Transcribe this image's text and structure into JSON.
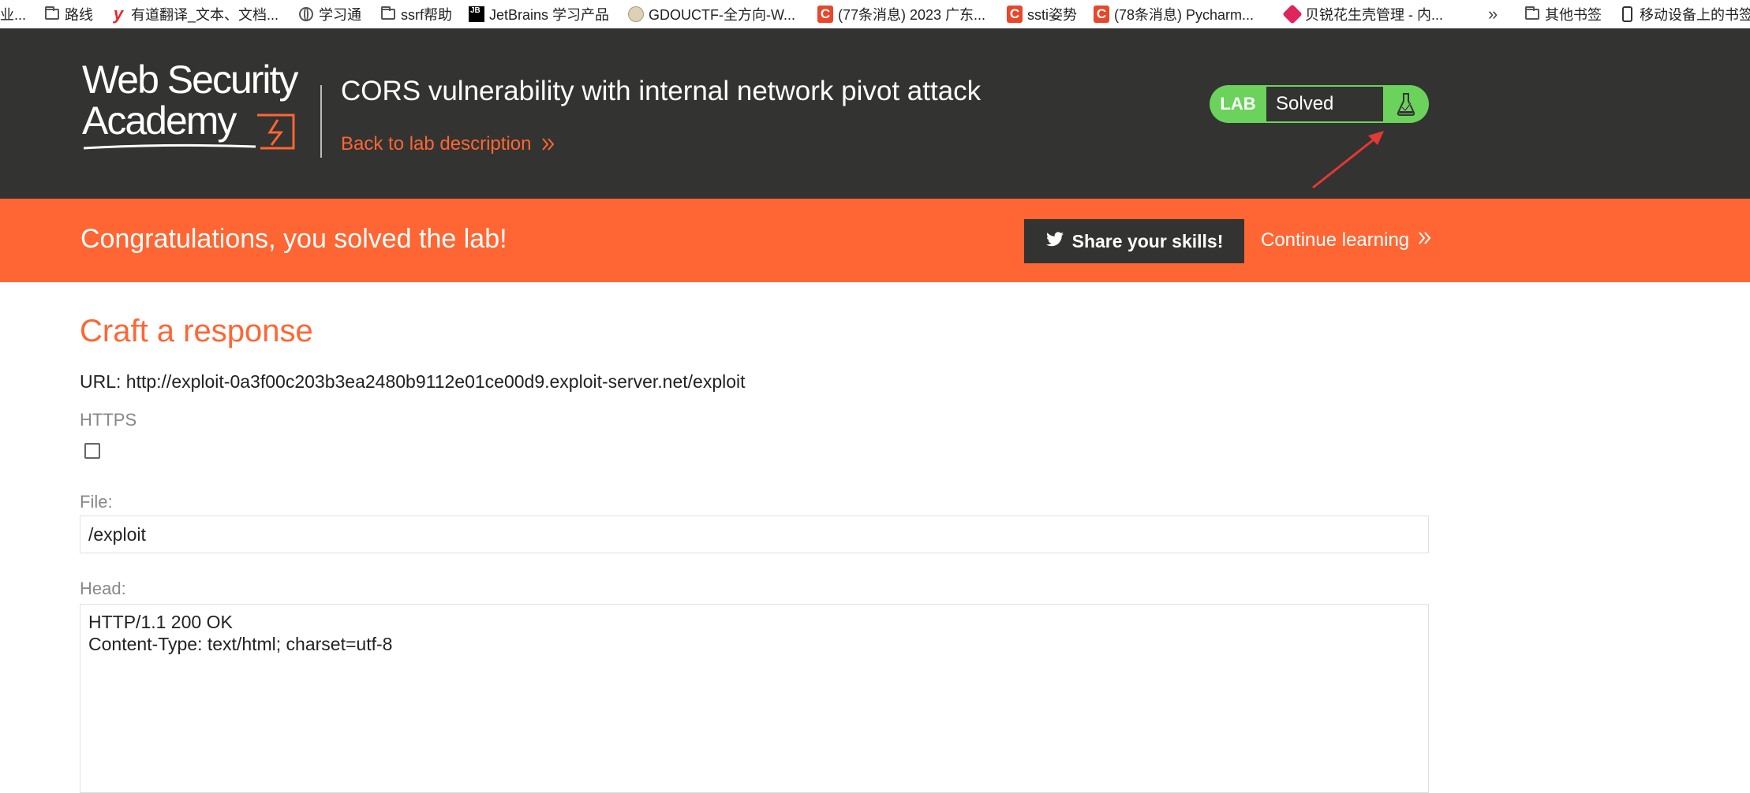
{
  "bookmarks": [
    {
      "icon": "folder-icon",
      "label": "业..."
    },
    {
      "icon": "folder-icon",
      "label": "路线"
    },
    {
      "icon": "youdao-icon",
      "label": "有道翻译_文本、文档..."
    },
    {
      "icon": "globe-icon",
      "label": "学习通"
    },
    {
      "icon": "folder-icon",
      "label": "ssrf帮助"
    },
    {
      "icon": "jetbrains-icon",
      "label": "JetBrains 学习产品"
    },
    {
      "icon": "sheep-icon",
      "label": "GDOUCTF-全方向-W..."
    },
    {
      "icon": "csdn-icon",
      "label": "(77条消息) 2023 广东..."
    },
    {
      "icon": "csdn-icon",
      "label": "ssti姿势"
    },
    {
      "icon": "csdn-icon",
      "label": "(78条消息) Pycharm..."
    },
    {
      "icon": "gem-icon",
      "label": "贝锐花生壳管理 - 内..."
    },
    {
      "icon": "folder-icon",
      "label": "其他书签"
    },
    {
      "icon": "phone-icon",
      "label": "移动设备上的书签"
    }
  ],
  "header": {
    "logo_line1": "Web Security",
    "logo_line2": "Academy",
    "lab_title": "CORS vulnerability with internal network pivot attack",
    "back_link": "Back to lab description",
    "lab_tag": "LAB",
    "lab_status": "Solved"
  },
  "banner": {
    "message": "Congratulations, you solved the lab!",
    "share_button": "Share your skills!",
    "continue_link": "Continue learning"
  },
  "form": {
    "title": "Craft a response",
    "url_line": "URL: http://exploit-0a3f00c203b3ea2480b9112e01ce00d9.exploit-server.net/exploit",
    "https_label": "HTTPS",
    "https_checked": false,
    "file_label": "File:",
    "file_value": "/exploit",
    "head_label": "Head:",
    "head_lines": [
      "HTTP/1.1 200 OK",
      "Content-Type: text/html; charset=utf-8"
    ]
  },
  "colors": {
    "accent": "#ff6633",
    "header_bg": "#333332",
    "lab_green": "#6bd25b",
    "annotation_red": "#e53935"
  }
}
